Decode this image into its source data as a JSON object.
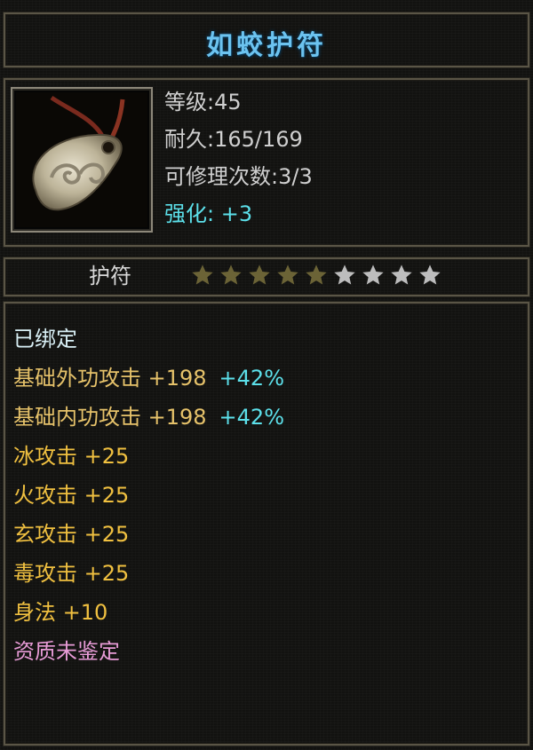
{
  "item": {
    "name": "如蛟护符",
    "level": "等级:45",
    "durability": "耐久:165/169",
    "repair_count": "可修理次数:3/3",
    "enhance": "强化: +3",
    "type": "护符",
    "stars": {
      "total": 9,
      "filled": 5
    }
  },
  "stats": {
    "bound": "已绑定",
    "outer_attack": "基础外功攻击 +198",
    "outer_attack_pct": "+42%",
    "inner_attack": "基础内功攻击 +198",
    "inner_attack_pct": "+42%",
    "ice_attack": "冰攻击 +25",
    "fire_attack": "火攻击 +25",
    "mystic_attack": "玄攻击 +25",
    "poison_attack": "毒攻击 +25",
    "agility": "身法 +10",
    "quality": "资质未鉴定"
  },
  "colors": {
    "title": "#6cc3f0",
    "bound": "#d8eff5",
    "base_stat": "#e6c26a",
    "percent": "#5ce0ea",
    "element_stat": "#f0c040",
    "quality": "#e79bd6",
    "star_filled": "#6b6336",
    "star_empty": "#bdbdbd"
  },
  "icons": {
    "item_image": "jade-amulet-icon",
    "star": "star-icon"
  }
}
